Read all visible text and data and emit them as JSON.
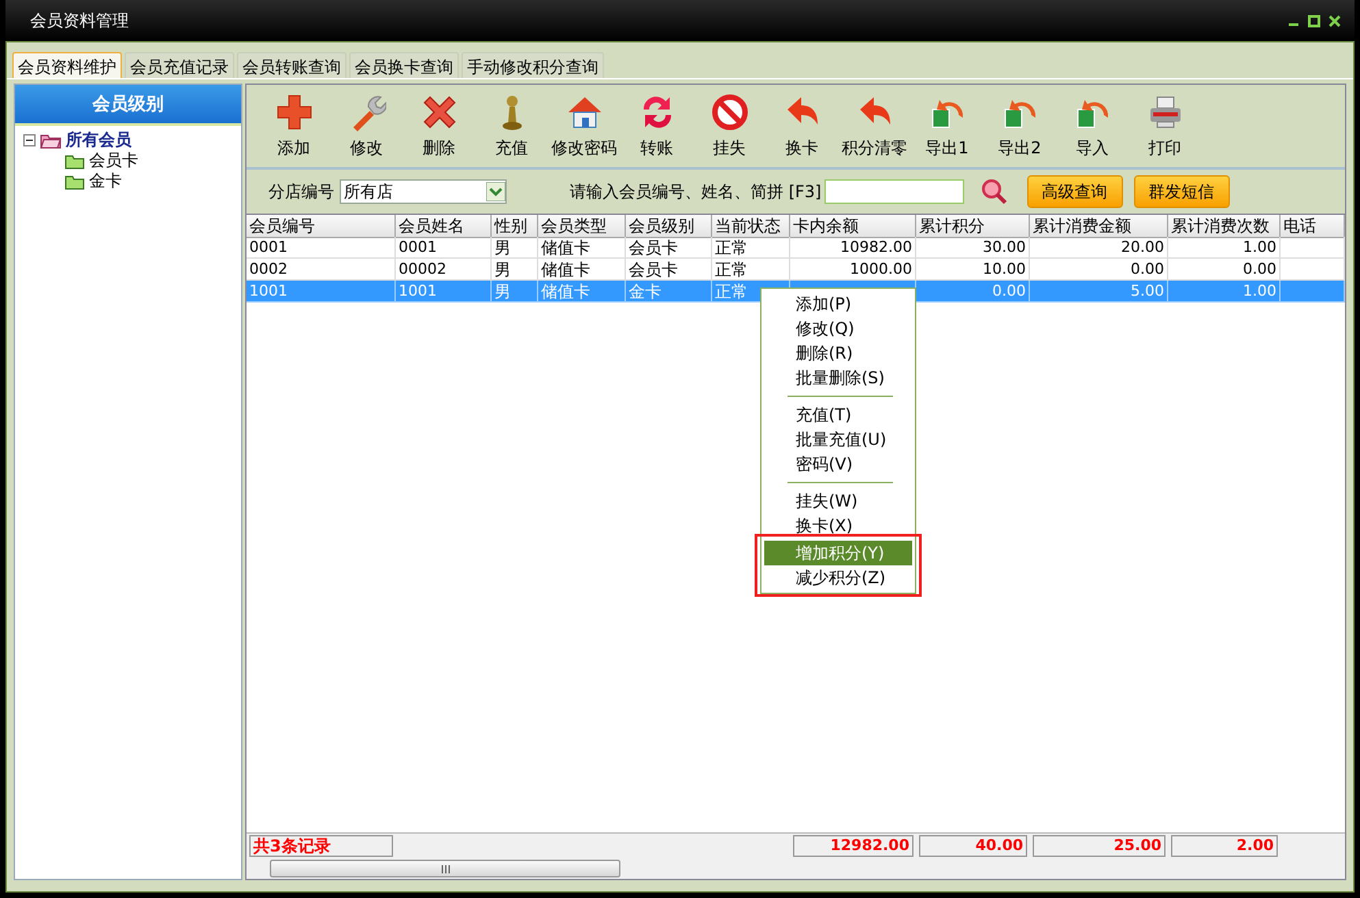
{
  "window": {
    "title": "会员资料管理"
  },
  "tabs": [
    {
      "label": "会员资料维护",
      "selected": true
    },
    {
      "label": "会员充值记录",
      "selected": false
    },
    {
      "label": "会员转账查询",
      "selected": false
    },
    {
      "label": "会员换卡查询",
      "selected": false
    },
    {
      "label": "手动修改积分查询",
      "selected": false
    }
  ],
  "sidebar": {
    "title": "会员级别",
    "tree": [
      {
        "label": "所有会员",
        "expanded": true,
        "children": [
          {
            "label": "会员卡"
          },
          {
            "label": "金卡"
          }
        ]
      }
    ]
  },
  "toolbar": [
    {
      "label": "添加"
    },
    {
      "label": "修改"
    },
    {
      "label": "删除"
    },
    {
      "label": "充值"
    },
    {
      "label": "修改密码"
    },
    {
      "label": "转账"
    },
    {
      "label": "挂失"
    },
    {
      "label": "换卡"
    },
    {
      "label": "积分清零"
    },
    {
      "label": "导出1"
    },
    {
      "label": "导出2"
    },
    {
      "label": "导入"
    },
    {
      "label": "打印"
    }
  ],
  "filter": {
    "store_label": "分店编号",
    "store_value": "所有店",
    "search_label": "请输入会员编号、姓名、简拼 [F3]",
    "buttons": [
      "高级查询",
      "群发短信"
    ]
  },
  "table": {
    "columns": [
      "会员编号",
      "会员姓名",
      "性别",
      "会员类型",
      "会员级别",
      "当前状态",
      "卡内余额",
      "累计积分",
      "累计消费金额",
      "累计消费次数",
      "电话"
    ],
    "rows": [
      {
        "selected": false,
        "cells": [
          "0001",
          "0001",
          "男",
          "储值卡",
          "会员卡",
          "正常",
          "10982.00",
          "30.00",
          "20.00",
          "1.00"
        ]
      },
      {
        "selected": false,
        "cells": [
          "0002",
          "00002",
          "男",
          "储值卡",
          "会员卡",
          "正常",
          "1000.00",
          "10.00",
          "0.00",
          "0.00"
        ]
      },
      {
        "selected": true,
        "cells": [
          "1001",
          "1001",
          "男",
          "储值卡",
          "金卡",
          "正常",
          null,
          "0.00",
          "5.00",
          "1.00"
        ]
      }
    ]
  },
  "footer": {
    "count": "共3条记录",
    "totals": [
      "12982.00",
      "40.00",
      "25.00",
      "2.00"
    ]
  },
  "context_menu": {
    "items": [
      {
        "kind": "item",
        "label": "添加(P)",
        "selected": false,
        "outlined": false
      },
      {
        "kind": "item",
        "label": "修改(Q)",
        "selected": false,
        "outlined": false
      },
      {
        "kind": "item",
        "label": "删除(R)",
        "selected": false,
        "outlined": false
      },
      {
        "kind": "item",
        "label": "批量删除(S)",
        "selected": false,
        "outlined": false
      },
      {
        "kind": "separator"
      },
      {
        "kind": "item",
        "label": "充值(T)",
        "selected": false,
        "outlined": false
      },
      {
        "kind": "item",
        "label": "批量充值(U)",
        "selected": false,
        "outlined": false
      },
      {
        "kind": "item",
        "label": "密码(V)",
        "selected": false,
        "outlined": false
      },
      {
        "kind": "separator"
      },
      {
        "kind": "item",
        "label": "挂失(W)",
        "selected": false,
        "outlined": false
      },
      {
        "kind": "item",
        "label": "换卡(X)",
        "selected": false,
        "outlined": false
      },
      {
        "kind": "item",
        "label": "增加积分(Y)",
        "selected": true,
        "outlined": true
      },
      {
        "kind": "item",
        "label": "减少积分(Z)",
        "selected": false,
        "outlined": true
      }
    ]
  }
}
